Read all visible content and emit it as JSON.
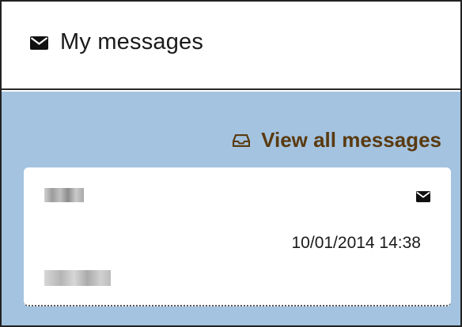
{
  "widget": {
    "title": "My messages",
    "title_icon": "envelope-icon"
  },
  "actions": {
    "view_all_label": "View all messages",
    "view_all_icon": "inbox-icon"
  },
  "messages": [
    {
      "timestamp": "10/01/2014 14:38",
      "status_icon": "envelope-icon"
    }
  ],
  "colors": {
    "panel_background": "#a3c3e0",
    "link_color": "#5a3a10"
  }
}
